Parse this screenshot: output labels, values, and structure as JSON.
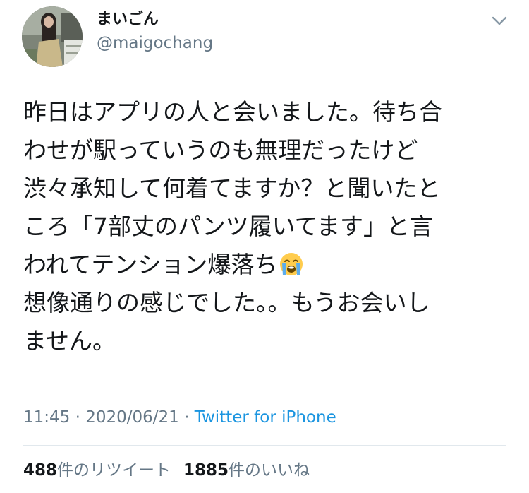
{
  "user": {
    "display_name": "まいごん",
    "handle": "@maigochang"
  },
  "tweet": {
    "lines": [
      "昨日はアプリの人と会いました。待ち合",
      "わせが駅っていうのも無理だったけど",
      "渋々承知して何着てますか？と聞いたと",
      "ころ「7部丈のパンツ履いてます」と言",
      "われてテンション爆落ち",
      "想像通りの感じでした。。もうお会いし",
      "ません。"
    ],
    "emoji": "loudly-crying-face"
  },
  "meta": {
    "time": "11:45",
    "separator1": " · ",
    "date": "2020/06/21",
    "separator2": " · ",
    "source": "Twitter for iPhone"
  },
  "stats": {
    "retweet_count": "488",
    "retweet_label": "件のリツイート",
    "like_count": "1885",
    "like_label": "件のいいね"
  },
  "colors": {
    "text": "#14171a",
    "secondary": "#657786",
    "link": "#1b95e0",
    "divider": "#e1e8ed"
  }
}
